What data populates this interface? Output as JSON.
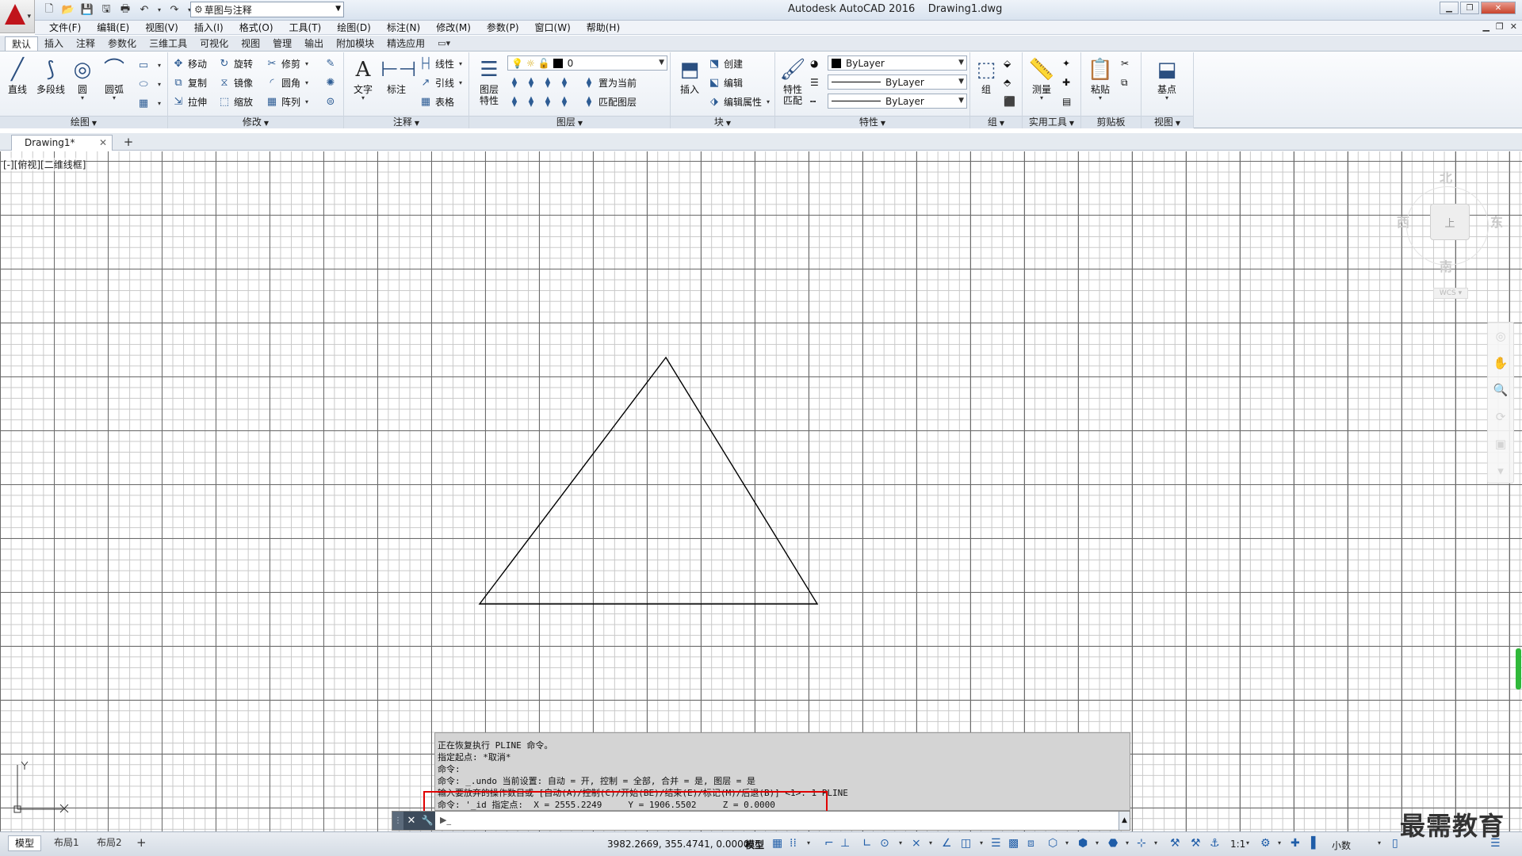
{
  "window": {
    "title": "Autodesk AutoCAD 2016    Drawing1.dwg",
    "workspace": "草图与注释"
  },
  "menu": [
    "文件(F)",
    "编辑(E)",
    "视图(V)",
    "插入(I)",
    "格式(O)",
    "工具(T)",
    "绘图(D)",
    "标注(N)",
    "修改(M)",
    "参数(P)",
    "窗口(W)",
    "帮助(H)"
  ],
  "ribbon_tabs": [
    "默认",
    "插入",
    "注释",
    "参数化",
    "三维工具",
    "可视化",
    "视图",
    "管理",
    "输出",
    "附加模块",
    "精选应用"
  ],
  "ribbon": {
    "draw": {
      "title": "绘图",
      "line": "直线",
      "polyline": "多段线",
      "circle": "圆",
      "arc": "圆弧"
    },
    "modify": {
      "title": "修改",
      "move": "移动",
      "rotate": "旋转",
      "trim": "修剪",
      "copy": "复制",
      "mirror": "镜像",
      "fillet": "圆角",
      "stretch": "拉伸",
      "scale": "缩放",
      "array": "阵列"
    },
    "annotation": {
      "title": "注释",
      "text": "文字",
      "dimension": "标注",
      "linear": "线性",
      "leader": "引线",
      "table": "表格"
    },
    "layers": {
      "title": "图层",
      "properties": "图层\n特性",
      "current_layer": "0",
      "make_current": "置为当前",
      "match_layer": "匹配图层"
    },
    "block": {
      "title": "块",
      "insert": "插入",
      "create": "创建",
      "edit": "编辑",
      "edit_attributes": "编辑属性"
    },
    "properties": {
      "title": "特性",
      "match": "特性\n匹配",
      "color": "ByLayer",
      "linetype": "ByLayer",
      "lineweight": "ByLayer"
    },
    "groups": {
      "title": "组",
      "group": "组"
    },
    "utilities": {
      "title": "实用工具",
      "measure": "测量"
    },
    "clipboard": {
      "title": "剪贴板",
      "paste": "粘贴"
    },
    "view": {
      "title": "视图",
      "base": "基点"
    }
  },
  "file_tab": {
    "name": "Drawing1*"
  },
  "viewport": {
    "label": "[-][俯视][二维线框]",
    "viewcube": {
      "north": "北",
      "south": "南",
      "west": "西",
      "east": "东",
      "face": "上",
      "wcs": "WCS"
    }
  },
  "command": {
    "history": [
      "正在恢复执行 PLINE 命令。",
      "指定起点: *取消*",
      "命令:",
      "命令: _.undo 当前设置: 自动 = 开, 控制 = 全部, 合并 = 是, 图层 = 是",
      "输入要放弃的操作数目或 [自动(A)/控制(C)/开始(BE)/结束(E)/标记(M)/后退(B)] <1>: 1 PLINE",
      "命令: '_id 指定点:  X = 2555.2249     Y = 1906.5502     Z = 0.0000"
    ],
    "input_value": ""
  },
  "status": {
    "layout_tabs": [
      "模型",
      "布局1",
      "布局2"
    ],
    "coords": "3982.2669, 355.4741, 0.0000",
    "space": "模型",
    "annotation_scale": "1:1",
    "units": "小数"
  },
  "watermark": "最需教育",
  "shape": {
    "type": "triangle",
    "vertices_label": "equilateral triangle drawn with PLINE"
  },
  "colors": {
    "accent": "#c0141b",
    "highlight": "#e10000",
    "ribbon_bg": "#e9eef4"
  }
}
